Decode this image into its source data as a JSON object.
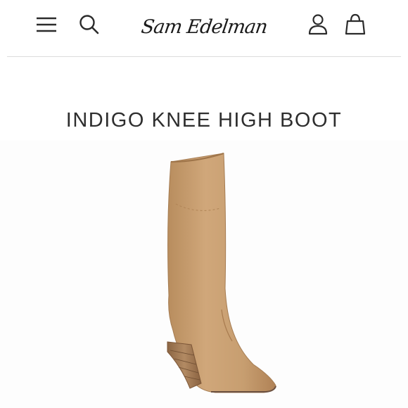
{
  "header": {
    "brand": "Sam Edelman",
    "menu_icon": "hamburger-menu-icon",
    "search_icon": "search-icon",
    "account_icon": "user-account-icon",
    "bag_icon": "shopping-bag-icon"
  },
  "product": {
    "title": "INDIGO KNEE HIGH BOOT",
    "image_description_color": "#c9a275"
  },
  "colors": {
    "text": "#2e2e2e",
    "divider": "#dcdcdc",
    "suede": "#c9a275",
    "heel": "#a07a55"
  }
}
